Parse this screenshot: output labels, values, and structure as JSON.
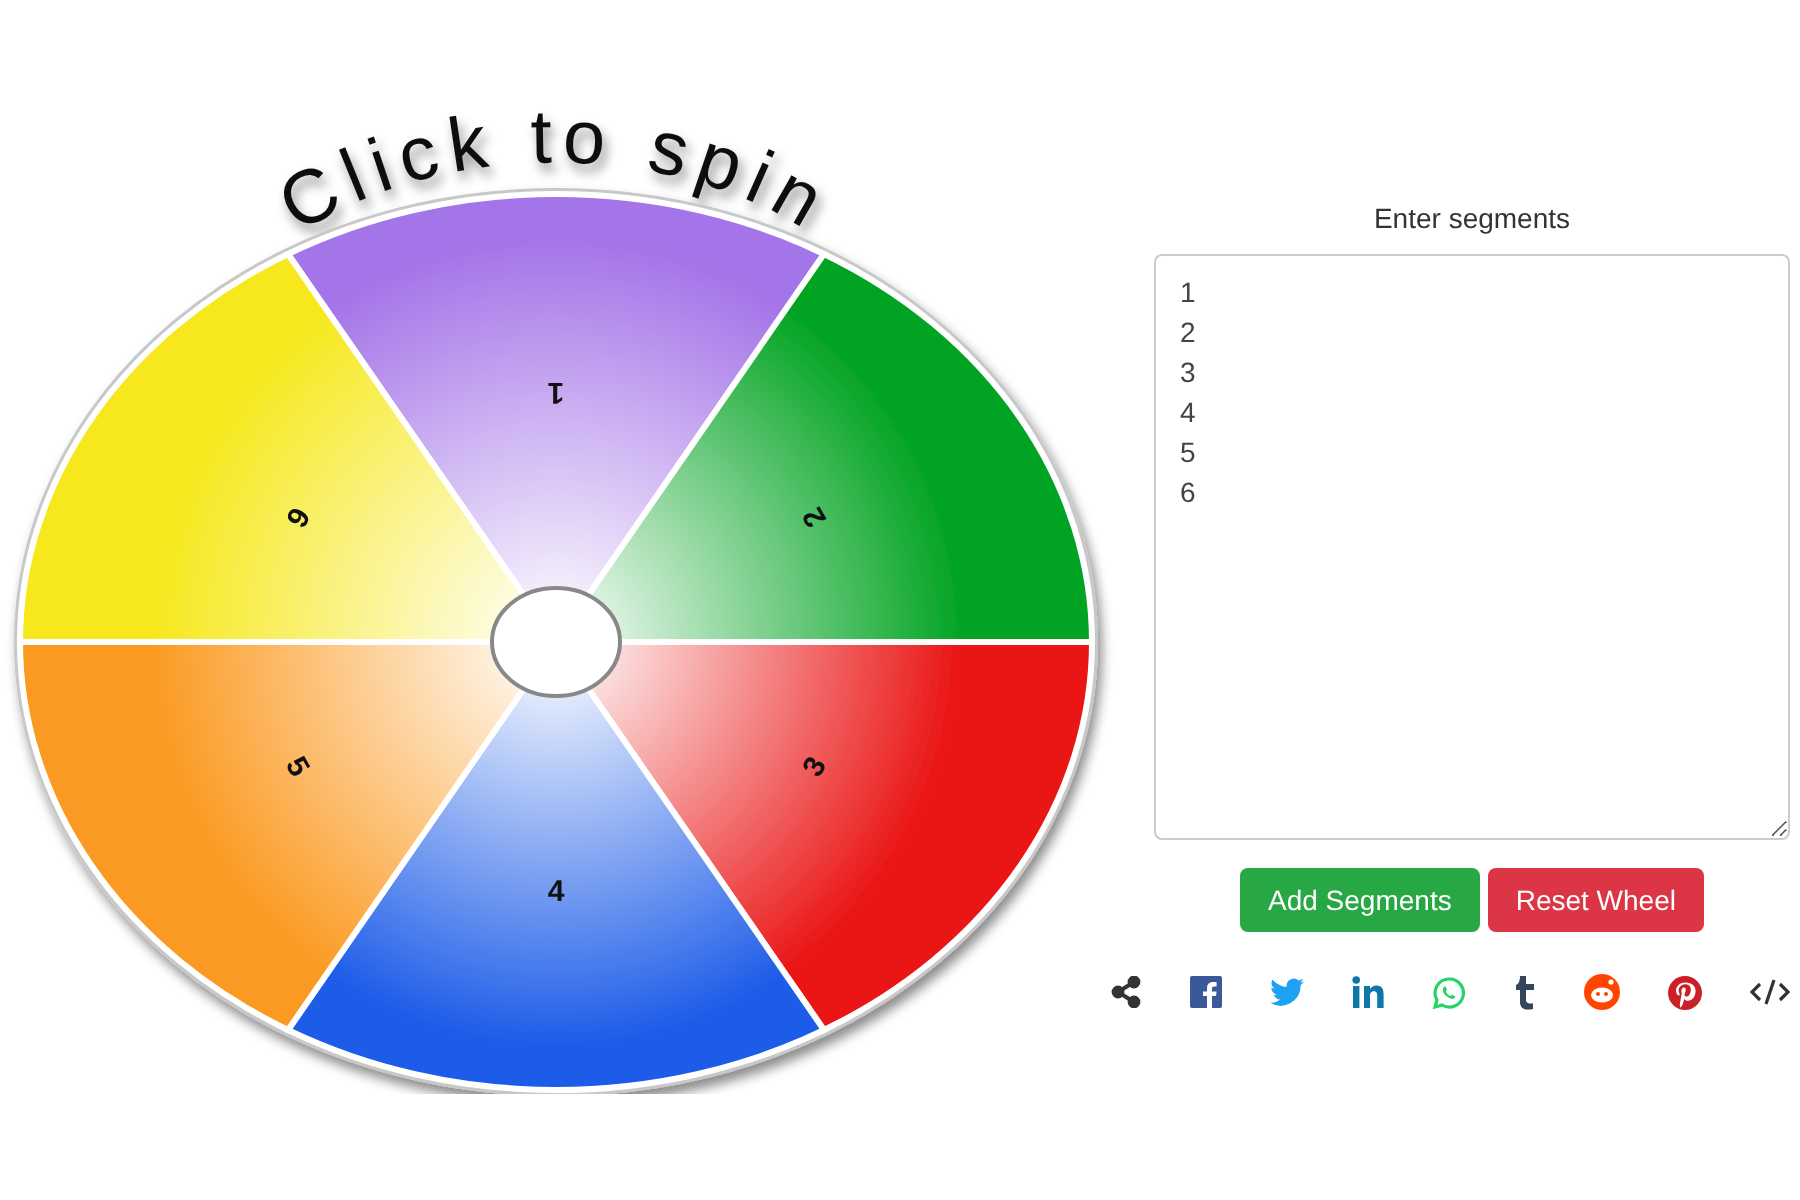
{
  "wheel": {
    "title": "Click to spin",
    "segments": [
      {
        "label": "1",
        "color": "#a474e8"
      },
      {
        "label": "2",
        "color": "#04a424"
      },
      {
        "label": "3",
        "color": "#ea1414"
      },
      {
        "label": "4",
        "color": "#1c5ce8"
      },
      {
        "label": "5",
        "color": "#fb9a22"
      },
      {
        "label": "6",
        "color": "#f6e81c"
      }
    ]
  },
  "editor": {
    "label": "Enter segments",
    "value": "1\n2\n3\n4\n5\n6"
  },
  "buttons": [
    {
      "label": "Add Segments",
      "kind": "success"
    },
    {
      "label": "Reset Wheel",
      "kind": "danger"
    }
  ]
}
